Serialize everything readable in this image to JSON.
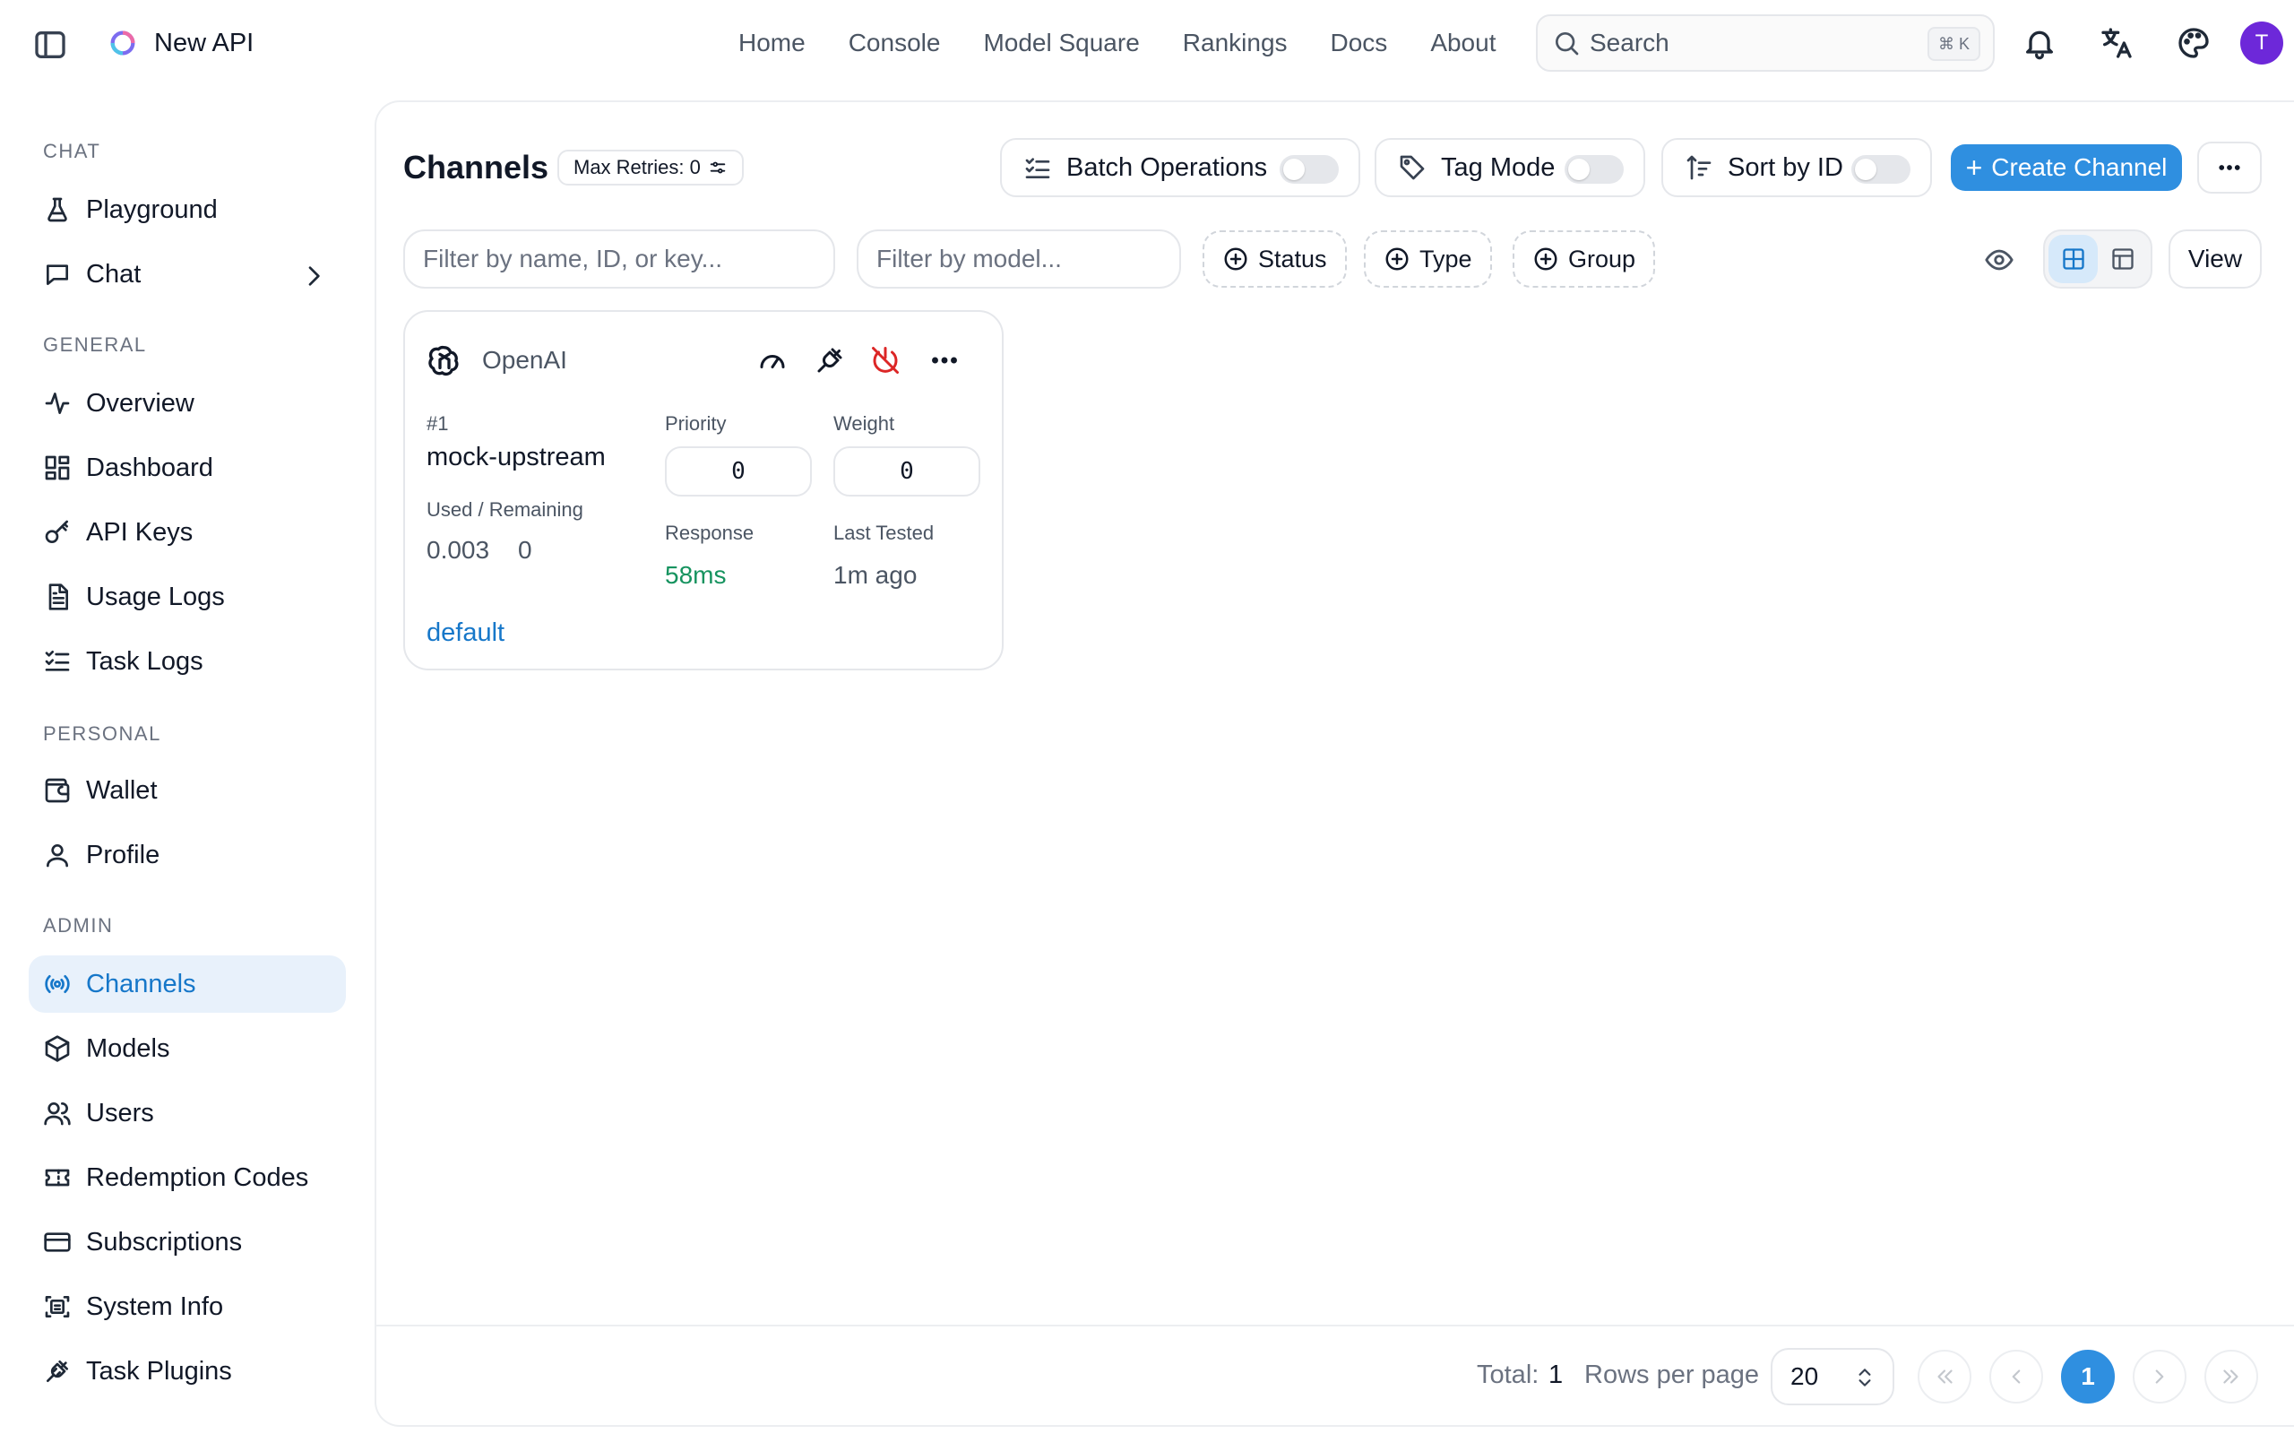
{
  "app": {
    "name": "New API",
    "avatar_initial": "T"
  },
  "topnav": {
    "links": [
      "Home",
      "Console",
      "Model Square",
      "Rankings",
      "Docs",
      "About"
    ],
    "search_label": "Search",
    "search_shortcut": "⌘ K"
  },
  "sidebar": {
    "sections": {
      "chat": "CHAT",
      "general": "GENERAL",
      "personal": "PERSONAL",
      "admin": "ADMIN"
    },
    "items": {
      "playground": "Playground",
      "chat": "Chat",
      "overview": "Overview",
      "dashboard": "Dashboard",
      "api_keys": "API Keys",
      "usage_logs": "Usage Logs",
      "task_logs": "Task Logs",
      "wallet": "Wallet",
      "profile": "Profile",
      "channels": "Channels",
      "models": "Models",
      "users": "Users",
      "redemption_codes": "Redemption Codes",
      "subscriptions": "Subscriptions",
      "system_info": "System Info",
      "task_plugins": "Task Plugins"
    },
    "active_item": "channels"
  },
  "page": {
    "title": "Channels",
    "max_retries": "Max Retries: 0",
    "options": {
      "batch": {
        "label": "Batch Operations",
        "on": false
      },
      "tag_mode": {
        "label": "Tag Mode",
        "on": false
      },
      "sort_by_id": {
        "label": "Sort by ID",
        "on": false
      }
    },
    "create_label": "Create Channel",
    "create_plus": "+",
    "filters": {
      "name_placeholder": "Filter by name, ID, or key...",
      "model_placeholder": "Filter by model...",
      "facets": [
        "Status",
        "Type",
        "Group"
      ]
    },
    "view_label": "View",
    "view_mode": "grid"
  },
  "channel_card": {
    "type": "OpenAI",
    "id": "#1",
    "name": "mock-upstream",
    "priority_label": "Priority",
    "priority": "0",
    "weight_label": "Weight",
    "weight": "0",
    "used_label": "Used / Remaining",
    "used": "0.003",
    "remaining": "0",
    "response_label": "Response",
    "response": "58ms",
    "last_tested_label": "Last Tested",
    "last_tested": "1m ago",
    "group": "default"
  },
  "pagination": {
    "total_label": "Total:",
    "total": "1",
    "rows_label": "Rows per page",
    "rows_per_page": "20",
    "current_page": "1"
  },
  "colors": {
    "accent": "#2f8fe0",
    "active_bg": "#e8f1fb",
    "success": "#16935f",
    "danger": "#dc2626",
    "avatar": "#6d28d9"
  }
}
